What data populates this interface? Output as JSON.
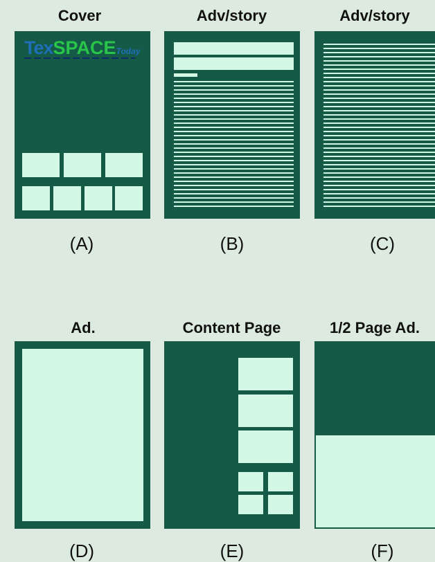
{
  "panels": [
    {
      "title": "Cover",
      "caption": "(A)"
    },
    {
      "title": "Adv/story",
      "caption": "(B)"
    },
    {
      "title": "Adv/story",
      "caption": "(C)"
    },
    {
      "title": "Ad.",
      "caption": "(D)"
    },
    {
      "title": "Content Page",
      "caption": "(E)"
    },
    {
      "title": "1/2 Page Ad.",
      "caption": "(F)"
    }
  ],
  "logo": {
    "part1": "Tex",
    "part2": "SPACE",
    "part3": "Today"
  },
  "colors": {
    "page": "#145a46",
    "block": "#d3f7e5",
    "background": "#dceadf"
  }
}
